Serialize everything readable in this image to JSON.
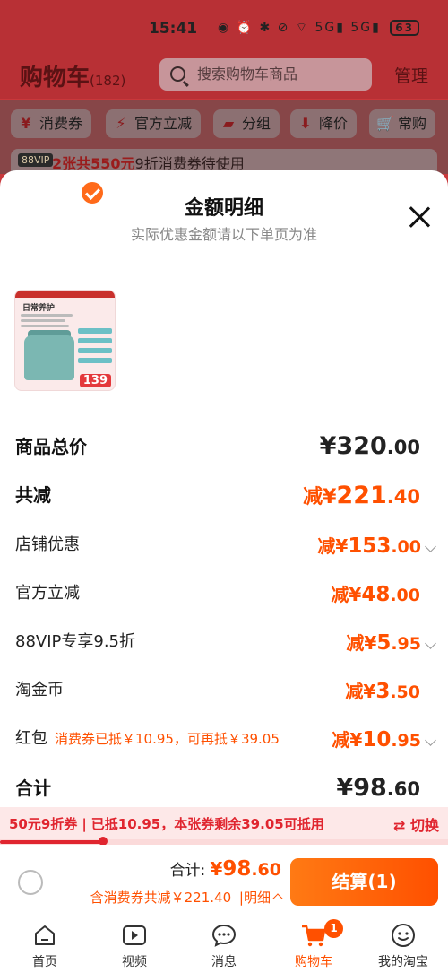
{
  "status_bar": {
    "time": "15:41",
    "icons_text": "◉ ⏰ ✱ ⊘ ⌔ 5G▮ 5G▮",
    "battery": "63"
  },
  "cart": {
    "title": "购物车",
    "count": "(182)",
    "search_placeholder": "搜索购物车商品",
    "manage": "管理",
    "filters": [
      {
        "icon": "coupon-icon",
        "glyph": "¥",
        "label": "消费券"
      },
      {
        "icon": "lightning-icon",
        "glyph": "⚡",
        "label": "官方立减"
      },
      {
        "icon": "folder-icon",
        "glyph": "▰",
        "label": "分组"
      },
      {
        "icon": "down-arrow-icon",
        "glyph": "⬇",
        "label": "降价"
      },
      {
        "icon": "cart-icon",
        "glyph": "🛒",
        "label": "常购"
      }
    ],
    "vip_badge": "88VIP",
    "vip_highlight": "2张共550元",
    "vip_text": "9折消费券待使用"
  },
  "sheet": {
    "title": "金额明细",
    "subtitle": "实际优惠金额请以下单页为准",
    "product": {
      "thumb_title": "日常养护",
      "price": "139"
    },
    "rows": {
      "total": {
        "label": "商品总价",
        "prefix": "¥",
        "main": "320",
        "cents": ".00"
      },
      "savings": {
        "label": "共减",
        "prefix": "减¥",
        "main": "221",
        "cents": ".40"
      },
      "shop": {
        "label": "店铺优惠",
        "prefix": "减¥",
        "main": "153",
        "cents": ".00"
      },
      "official": {
        "label": "官方立减",
        "prefix": "减¥",
        "main": "48",
        "cents": ".00"
      },
      "vip": {
        "label": "88VIP专享9.5折",
        "prefix": "减¥",
        "main": "5",
        "cents": ".95"
      },
      "coins": {
        "label": "淘金币",
        "prefix": "减¥",
        "main": "3",
        "cents": ".50"
      },
      "redpacket": {
        "label": "红包",
        "note": "消费券已抵￥10.95，可再抵￥39.05",
        "prefix": "减¥",
        "main": "10",
        "cents": ".95"
      },
      "subtotal": {
        "label": "合计",
        "prefix": "¥",
        "main": "98",
        "cents": ".60"
      }
    }
  },
  "coupon_strip": {
    "name": "50元9折券",
    "sep": "|",
    "text": "已抵10.95，本张券剩余39.05可抵用",
    "switch": "⇄ 切换",
    "progress": 0.23
  },
  "checkout": {
    "total_label": "合计:",
    "total_prefix": "¥",
    "total_main": "98",
    "total_cents": ".60",
    "discount_text": "含消费券共减￥221.40",
    "detail_sep": "|",
    "detail_label": "明细",
    "button": "结算(1)"
  },
  "tabs": [
    {
      "label": "首页",
      "icon": "home-icon"
    },
    {
      "label": "视频",
      "icon": "video-icon"
    },
    {
      "label": "消息",
      "icon": "message-icon"
    },
    {
      "label": "购物车",
      "icon": "cart-icon",
      "badge": "1"
    },
    {
      "label": "我的淘宝",
      "icon": "profile-icon"
    }
  ],
  "colors": {
    "accent": "#ff5000",
    "coupon_red": "#e0252f",
    "header_red": "#c9383b"
  }
}
